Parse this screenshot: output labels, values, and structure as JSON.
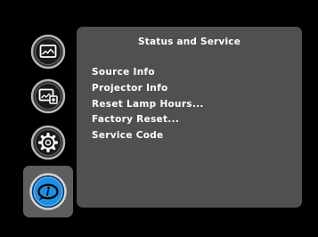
{
  "panel": {
    "title": "Status and Service"
  },
  "menu": {
    "items": [
      {
        "label": "Source Info"
      },
      {
        "label": "Projector Info"
      },
      {
        "label": "Reset Lamp Hours..."
      },
      {
        "label": "Factory Reset..."
      },
      {
        "label": "Service Code"
      }
    ]
  },
  "icons": [
    {
      "name": "picture-settings-icon",
      "selected": false
    },
    {
      "name": "picture-advanced-icon",
      "selected": false
    },
    {
      "name": "setup-gear-icon",
      "selected": false
    },
    {
      "name": "status-info-icon",
      "selected": true
    }
  ],
  "colors": {
    "background": "#000000",
    "panel": "#505050",
    "selection": "#5e5e5e",
    "selected_icon_accent": "#1e8fe0",
    "text": "#ffffff"
  }
}
